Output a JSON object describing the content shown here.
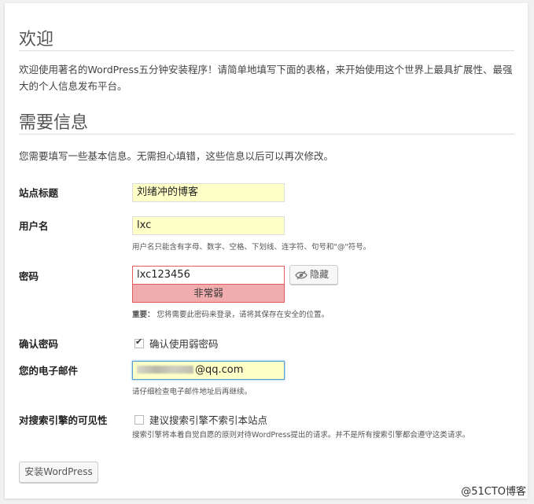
{
  "welcome": {
    "heading": "欢迎",
    "text": "欢迎使用著名的WordPress五分钟安装程序！请简单地填写下面的表格，来开始使用这个世界上最具扩展性、最强大的个人信息发布平台。"
  },
  "info": {
    "heading": "需要信息",
    "text": "您需要填写一些基本信息。无需担心填错，这些信息以后可以再次修改。"
  },
  "form": {
    "site_title": {
      "label": "站点标题",
      "value": "刘绪冲的博客"
    },
    "username": {
      "label": "用户名",
      "value": "lxc",
      "hint": "用户名只能含有字母、数字、空格、下划线、连字符、句号和\"@\"符号。"
    },
    "password": {
      "label": "密码",
      "value": "lxc123456",
      "strength": "非常弱",
      "hide_label": "隐藏",
      "hint_strong": "重要：",
      "hint": "您将需要此密码来登录，请将其保存在安全的位置。"
    },
    "confirm_password": {
      "label": "确认密码",
      "checkbox_label": "确认使用弱密码",
      "checked": true
    },
    "email": {
      "label": "您的电子邮件",
      "value_suffix": "@qq.com",
      "hint": "请仔细检查电子邮件地址后再继续。"
    },
    "search_visibility": {
      "label": "对搜索引擎的可见性",
      "checkbox_label": "建议搜索引擎不索引本站点",
      "checked": false,
      "hint": "搜索引擎将本着自觉自愿的原则对待WordPress提出的请求。并不是所有搜索引擎都会遵守这类请求。"
    },
    "install_label": "安装WordPress"
  },
  "watermark": "@51CTO博客",
  "colors": {
    "field_bg": "#ffffc8",
    "weak_bg": "#f1adad",
    "weak_border": "#e35b5b",
    "focus_border": "#5b9dd9"
  }
}
